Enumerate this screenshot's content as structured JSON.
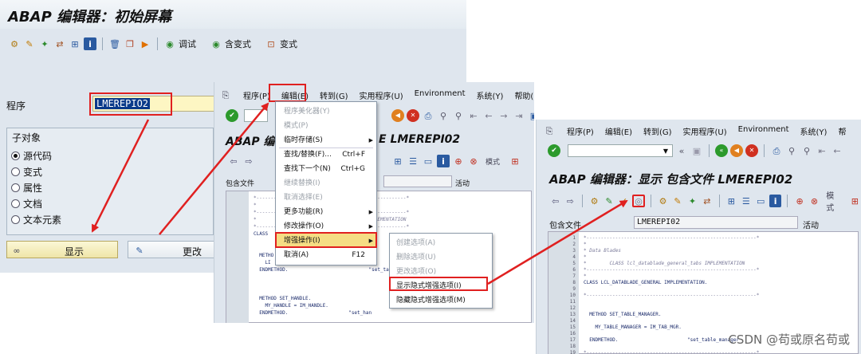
{
  "win1": {
    "title": "ABAP 编辑器：初始屏幕",
    "btn_test": "调试",
    "btn_with_variant": "含变式",
    "btn_variant": "变式",
    "program_label": "程序",
    "program_value": "LMEREPIO2",
    "subobjects_title": "子对象",
    "radios": [
      "源代码",
      "变式",
      "属性",
      "文档",
      "文本元素"
    ],
    "display_btn": "显示",
    "change_btn": "更改"
  },
  "win2": {
    "menus": [
      "程序(P)",
      "编辑(E)",
      "转到(G)",
      "实用程序(U)",
      "Environment",
      "系统(Y)",
      "帮助(H)"
    ],
    "title": "ABAP 编",
    "title_suffix": "E LMEREPI02",
    "include_label": "包含文件",
    "active": "活动",
    "mode_label": "模式",
    "edit_menu": [
      {
        "label": "程序美化器(Y)",
        "shortcut": "",
        "disabled": true,
        "arrow": false
      },
      {
        "label": "模式(P)",
        "shortcut": "",
        "disabled": true,
        "arrow": false
      },
      {
        "label": "临时存储(S)",
        "shortcut": "",
        "disabled": false,
        "arrow": true
      },
      {
        "label": "查找/替换(F)...",
        "shortcut": "Ctrl+F",
        "disabled": false,
        "arrow": false
      },
      {
        "label": "查找下一个(N)",
        "shortcut": "Ctrl+G",
        "disabled": false,
        "arrow": false
      },
      {
        "label": "继续替换(I)",
        "shortcut": "",
        "disabled": true,
        "arrow": false
      },
      {
        "label": "取消选择(E)",
        "shortcut": "",
        "disabled": true,
        "arrow": false
      },
      {
        "label": "更多功能(R)",
        "shortcut": "",
        "disabled": false,
        "arrow": true
      },
      {
        "label": "修改操作(O)",
        "shortcut": "",
        "disabled": false,
        "arrow": true
      },
      {
        "label": "增强操作(I)",
        "shortcut": "",
        "disabled": false,
        "arrow": true
      },
      {
        "label": "取消(A)",
        "shortcut": "F12",
        "disabled": false,
        "arrow": false
      }
    ],
    "sub_menu": [
      {
        "label": "创建选项(A)",
        "disabled": true
      },
      {
        "label": "删除选项(U)",
        "disabled": true
      },
      {
        "label": "更改选项(O)",
        "disabled": true
      },
      {
        "label": "显示隐式增强选项(I)",
        "disabled": false
      },
      {
        "label": "隐藏隐式增强选项(M)",
        "disabled": false
      }
    ],
    "code": [
      "*----------------------------------------------------*",
      "*",
      "*----------------------------------------------------*",
      "*                                      IMPLEMENTATION",
      "*----------------------------------------------------*",
      "CLASS",
      "",
      "",
      "  METHO",
      "    LI",
      "  ENDMETHOD.                            \"set_tabl",
      "",
      "",
      "",
      "  METHOD SET_HANDLE.",
      "    MY_HANDLE = IM_HANDLE.",
      "  ENDMETHOD.                     \"set_han"
    ]
  },
  "win3": {
    "menus": [
      "程序(P)",
      "编辑(E)",
      "转到(G)",
      "实用程序(U)",
      "Environment",
      "系统(Y)",
      "帮"
    ],
    "title": "ABAP 编辑器：显示 包含文件 LMEREPI02",
    "include_label": "包含文件",
    "include_value": "LMEREPI02",
    "active": "活动",
    "mode_label": "模式",
    "line_numbers": [
      "1",
      "2",
      "3",
      "4",
      "5",
      "6",
      "7",
      "8",
      "9",
      "10",
      "11",
      "12",
      "13",
      "14",
      "15",
      "16",
      "17",
      "18",
      "19"
    ],
    "code": [
      "*-----------------------------------------------------------*",
      "*",
      "* Data Blades",
      "*",
      "*        CLASS lcl_datablade_general_tabs IMPLEMENTATION",
      "*-----------------------------------------------------------*",
      "*",
      "CLASS LCL_DATABLADE_GENERAL IMPLEMENTATION.",
      "",
      "*-----------------------------------------------------------*",
      "",
      "",
      "  METHOD SET_TABLE_MANAGER.",
      "",
      "    MY_TABLE_MANAGER = IM_TAB_MGR.",
      "",
      "  ENDMETHOD.                        \"set_table_manager",
      "",
      "*-----------------------------------------------------------*"
    ]
  },
  "watermark": "CSDN @苟或原名苟或"
}
